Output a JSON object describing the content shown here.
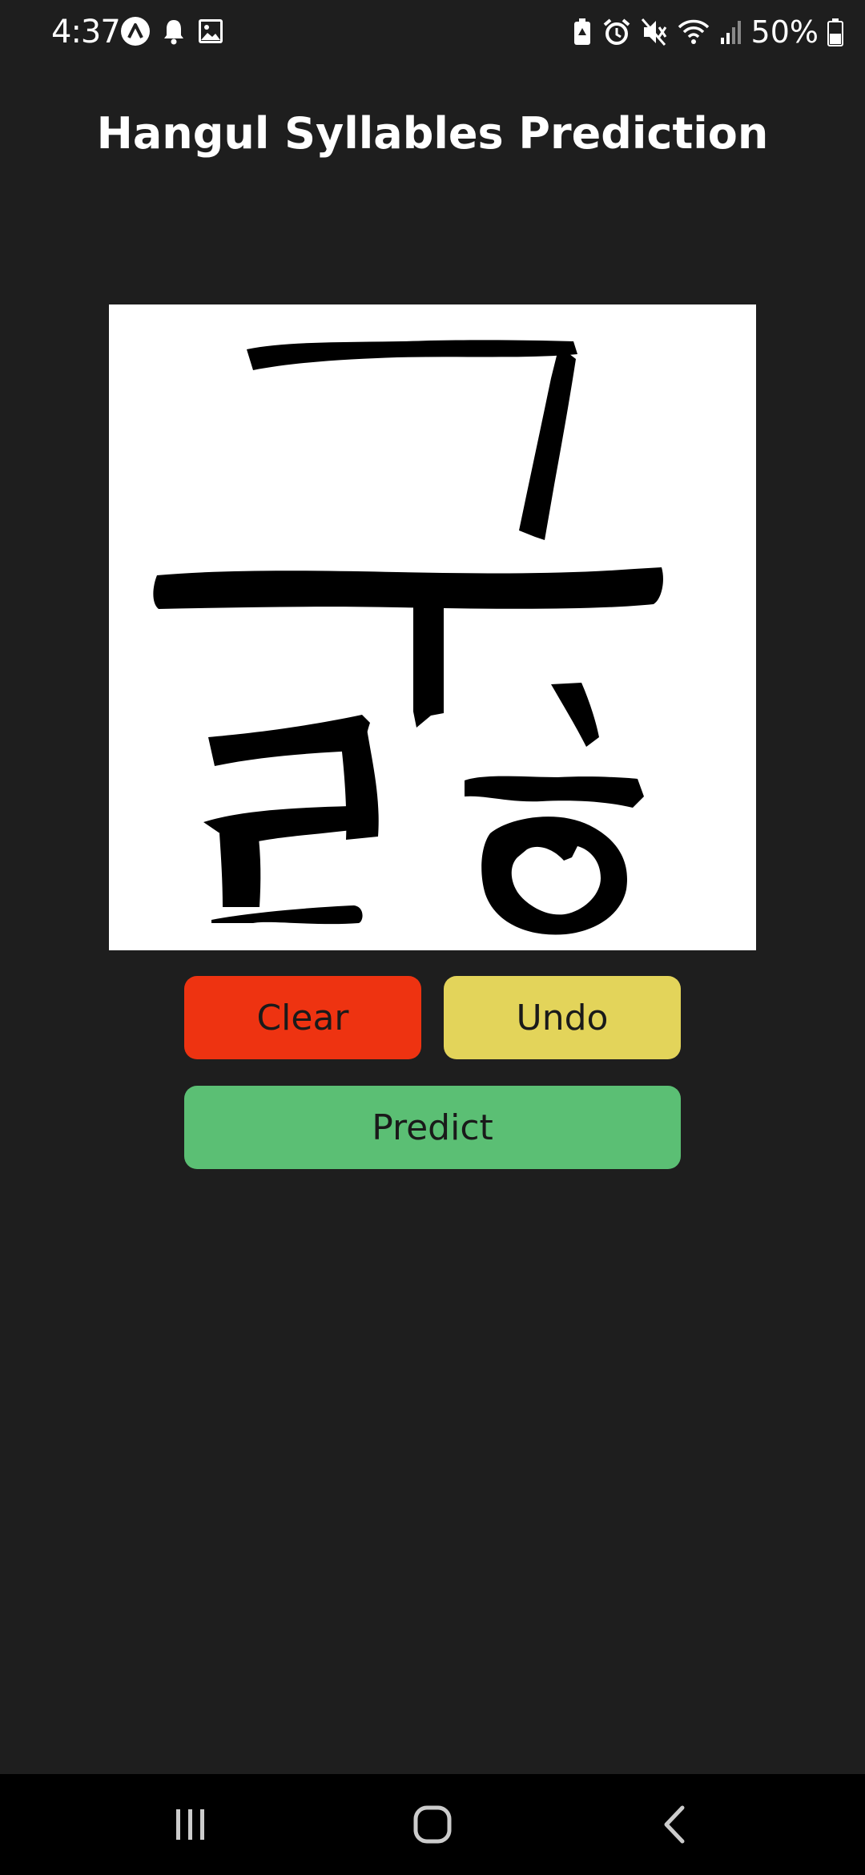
{
  "status_bar": {
    "time": "4:37",
    "left_icons": [
      "app-a-icon",
      "notification-bell-icon",
      "gallery-image-icon"
    ],
    "right_icons": [
      "battery-saver-icon",
      "alarm-icon",
      "mute-icon",
      "wifi-icon",
      "signal-icon"
    ],
    "battery": "50%"
  },
  "app": {
    "title": "Hangul Syllables Prediction"
  },
  "buttons": {
    "clear": "Clear",
    "undo": "Undo",
    "predict": "Predict"
  },
  "colors": {
    "background": "#1e1e1e",
    "clear": "#ee3311",
    "undo": "#e3d45a",
    "predict": "#5bbf74"
  },
  "nav_bar": {
    "items": [
      "recent-apps-icon",
      "home-icon",
      "back-icon"
    ]
  }
}
